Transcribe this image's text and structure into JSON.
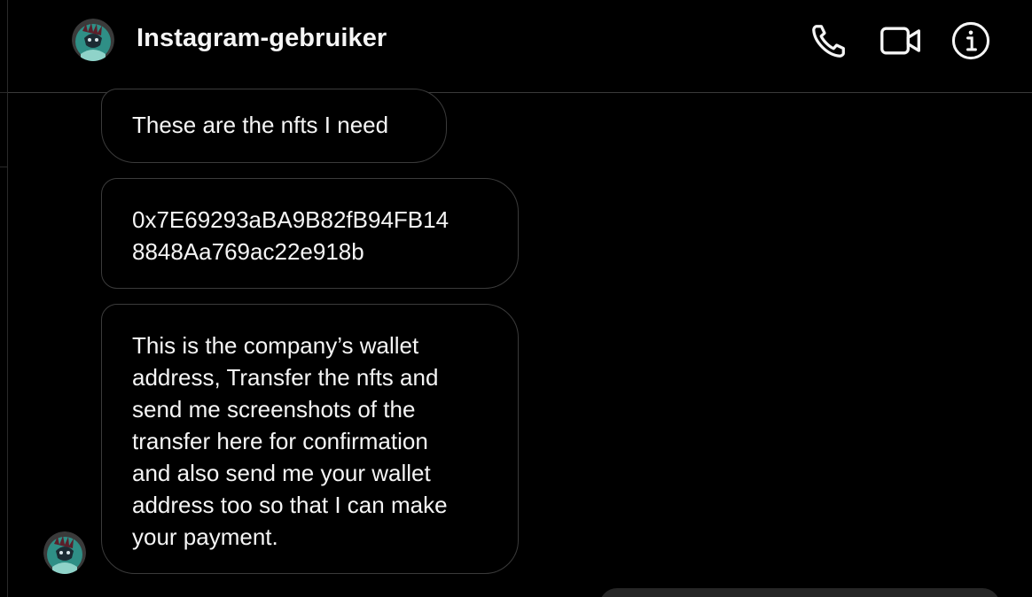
{
  "header": {
    "username": "Instagram-gebruiker",
    "avatar_icon": "user-avatar",
    "call_icon": "phone-icon",
    "video_icon": "video-camera-icon",
    "info_icon": "info-icon"
  },
  "messages": [
    {
      "text": "These are the nfts I need"
    },
    {
      "text": "0x7E69293aBA9B82fB94FB14\n8848Aa769ac22e918b"
    },
    {
      "text": "This is the company’s wallet\naddress, Transfer the nfts and\nsend me screenshots of the\ntransfer here for confirmation\nand also send me your wallet\naddress too so that I can make\nyour payment."
    }
  ],
  "colors": {
    "background": "#000000",
    "bubble_border": "#3b3b3b",
    "text": "#f5f5f5",
    "outgoing_bubble": "#262626",
    "avatar_bg": "#2f8f86"
  }
}
